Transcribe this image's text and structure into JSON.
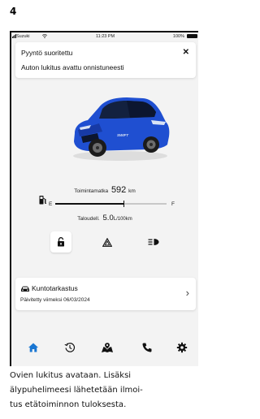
{
  "step_number": "4",
  "status_bar": {
    "carrier": "Suzuki",
    "time": "11:23 PM",
    "battery": "100%"
  },
  "notification": {
    "title": "Pyyntö suoritettu",
    "body": "Auton lukitus avattu onnistuneesti",
    "close_icon": "close-icon"
  },
  "vehicle": {
    "image": "car-image",
    "badge": "SWIFT",
    "range_label": "Toimintamatka",
    "range_value": "592",
    "range_unit": "km",
    "fuel_empty_label": "E",
    "fuel_full_label": "F",
    "fuel_level": 0.62,
    "consumption_label": "Taloudell.",
    "consumption_value": "5.0",
    "consumption_unit": "L/100km",
    "body_color": "#1f4fd1"
  },
  "controls": [
    {
      "name": "lock",
      "icon": "unlock-icon",
      "active": true
    },
    {
      "name": "hazard",
      "icon": "hazard-icon",
      "active": false
    },
    {
      "name": "lights",
      "icon": "headlight-icon",
      "active": false
    }
  ],
  "service_card": {
    "title": "Kuntotarkastus",
    "subtitle": "Päivitetty viimeksi 06/03/2024",
    "icon": "car-icon",
    "chevron_icon": "chevron-right-icon"
  },
  "bottom_nav": [
    {
      "name": "home",
      "icon": "home-icon",
      "active": true
    },
    {
      "name": "history",
      "icon": "history-icon",
      "active": false
    },
    {
      "name": "map",
      "icon": "map-pin-icon",
      "active": false
    },
    {
      "name": "call",
      "icon": "phone-icon",
      "active": false
    },
    {
      "name": "settings",
      "icon": "gear-icon",
      "active": false
    }
  ],
  "caption": {
    "line1": "Ovien lukitus avataan. Lisäksi",
    "line2": "älypuhelimeesi lähetetään ilmoi-",
    "line3": "tus etätoiminnon tuloksesta."
  },
  "colors": {
    "accent": "#1976d2",
    "background": "#f3f3f3",
    "card": "#ffffff",
    "text": "#111111"
  }
}
